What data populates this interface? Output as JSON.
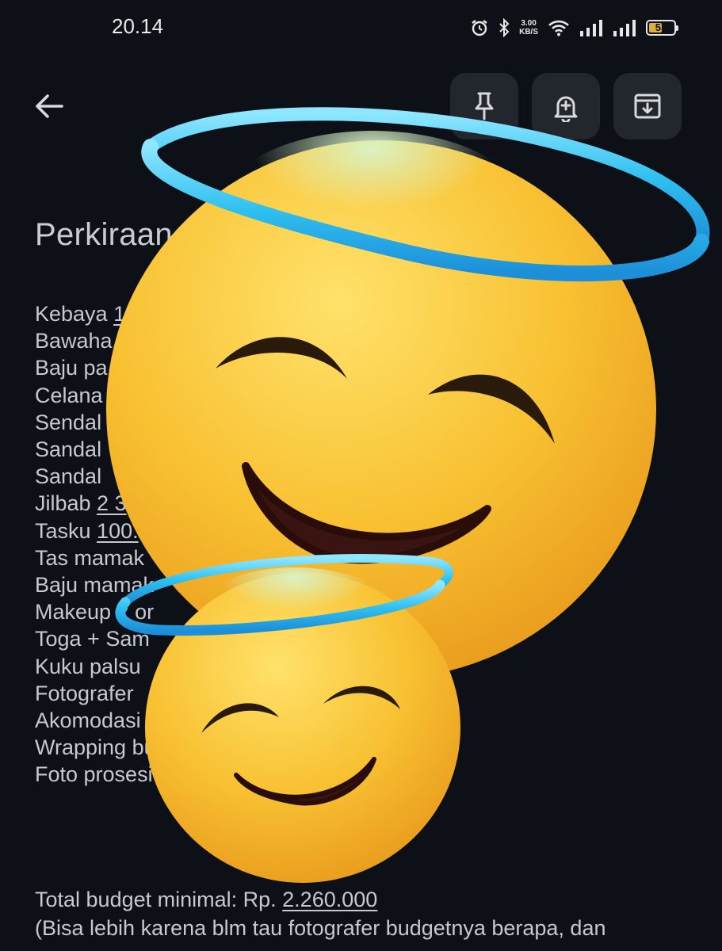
{
  "status_bar": {
    "time": "20.14",
    "net_speed_value": "3.00",
    "net_speed_unit": "KB/S",
    "battery": "53"
  },
  "toolbar": {
    "back_icon": "arrow-left-icon",
    "pin_icon": "pin-icon",
    "reminder_icon": "bell-plus-icon",
    "archive_icon": "archive-icon"
  },
  "note": {
    "title": "Perkiraan",
    "lines": [
      {
        "text": "Kebaya ",
        "underlined": "1"
      },
      {
        "text": "Bawaha",
        "underlined": ""
      },
      {
        "text": "Baju pa",
        "underlined": ""
      },
      {
        "text": "Celana",
        "underlined": ""
      },
      {
        "text": "Sendal",
        "underlined": ""
      },
      {
        "text": "Sandal",
        "underlined": ""
      },
      {
        "text": "Sandal ",
        "underlined": ""
      },
      {
        "text": "Jilbab ",
        "underlined": "2 3"
      },
      {
        "text": "Tasku ",
        "underlined": "100."
      },
      {
        "text": "Tas mamak",
        "underlined": ""
      },
      {
        "text": "Baju mamak",
        "underlined": ""
      },
      {
        "text": "Makeup 2 or",
        "underlined": ""
      },
      {
        "text": "Toga + Sam",
        "underlined": ""
      },
      {
        "text": "Kuku palsu",
        "underlined": ""
      },
      {
        "text": "Fotografer",
        "underlined": ""
      },
      {
        "text": "Akomodasi",
        "underlined": ""
      },
      {
        "text": "Wrapping bu",
        "underlined": ""
      },
      {
        "text": "Foto prosesi ",
        "underlined": "20"
      }
    ],
    "total_label": "Total budget minimal: Rp. ",
    "total_value": "2.260.000",
    "remark": "(Bisa lebih karena blm tau fotografer budgetnya berapa, dan"
  },
  "overlay": {
    "large_emoji_icon": "smiling-face-with-halo-icon",
    "small_emoji_icon": "smiling-face-with-halo-icon"
  },
  "colors": {
    "background": "#0d1117",
    "button_bg": "#22262d",
    "text": "#c6c9ce",
    "halo": "#3cc6f0",
    "emoji_face": "#f6c233"
  }
}
